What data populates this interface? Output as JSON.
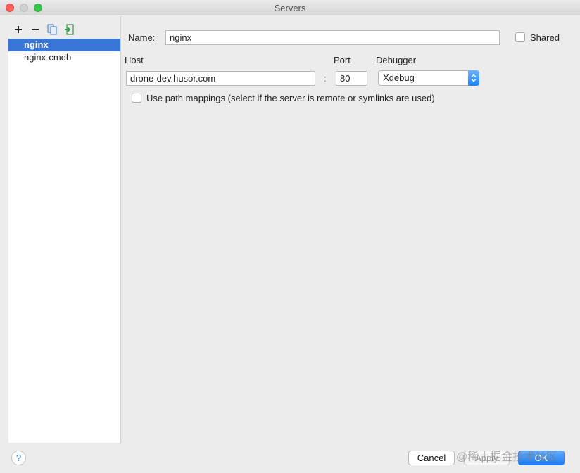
{
  "window": {
    "title": "Servers"
  },
  "toolbar": {
    "add_icon": "plus-icon",
    "remove_icon": "minus-icon",
    "copy_icon": "copy-icon",
    "import_icon": "import-icon"
  },
  "servers": {
    "items": [
      {
        "label": "nginx",
        "selected": true
      },
      {
        "label": "nginx-cmdb",
        "selected": false
      }
    ]
  },
  "form": {
    "name_label": "Name:",
    "name_value": "nginx",
    "shared_label": "Shared",
    "shared_checked": false,
    "host_label": "Host",
    "host_value": "drone-dev.husor.com",
    "separator": ":",
    "port_label": "Port",
    "port_value": "80",
    "debugger_label": "Debugger",
    "debugger_value": "Xdebug",
    "path_mappings_label": "Use path mappings (select if the server is remote or symlinks are used)",
    "path_mappings_checked": false
  },
  "footer": {
    "help_label": "?",
    "cancel_label": "Cancel",
    "apply_label": "Apply",
    "ok_label": "OK"
  },
  "watermark": "@稀土掘金技术社区",
  "colors": {
    "selection": "#3875d7",
    "primary_button": "#1b7df5"
  }
}
